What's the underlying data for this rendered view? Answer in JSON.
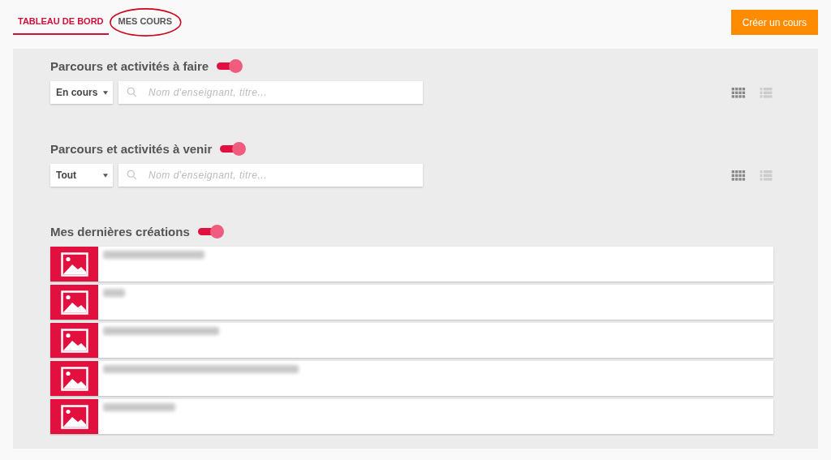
{
  "tabs": [
    {
      "label": "TABLEAU DE BORD",
      "selected": true,
      "circled": false
    },
    {
      "label": "MES COURS",
      "selected": false,
      "circled": true
    }
  ],
  "create_button": "Créer un cours",
  "sections": [
    {
      "title": "Parcours et activités à faire",
      "on": true,
      "filter": "En cours",
      "search": {
        "placeholder": "Nom d'enseignant, titre..."
      },
      "views": [
        {
          "kind": "grid",
          "selected": true
        },
        {
          "kind": "list",
          "selected": false
        }
      ]
    },
    {
      "title": "Parcours et activités à venir",
      "on": true,
      "filter": "Tout",
      "search": {
        "placeholder": "Nom d'enseignant, titre..."
      },
      "views": [
        {
          "kind": "grid",
          "selected": true
        },
        {
          "kind": "list",
          "selected": false
        }
      ]
    }
  ],
  "recent": {
    "title": "Mes dernières créations",
    "on": true,
    "items": [
      {
        "kind": "course"
      },
      {
        "kind": "course"
      },
      {
        "kind": "course"
      },
      {
        "kind": "course"
      },
      {
        "kind": "course"
      }
    ]
  }
}
